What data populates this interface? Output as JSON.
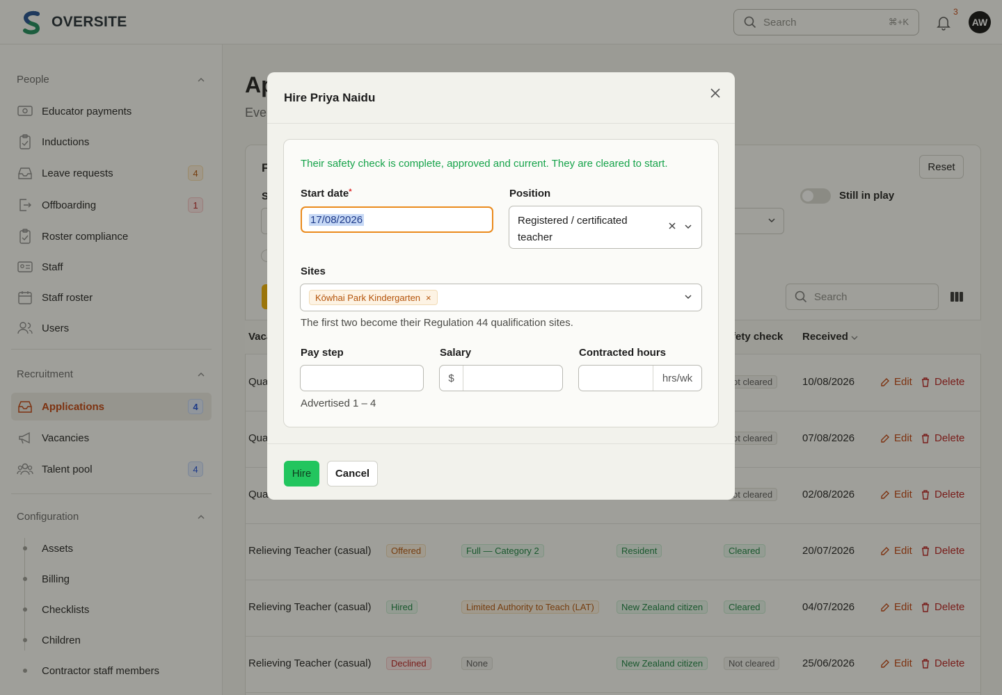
{
  "app": {
    "name": "OVERSITE",
    "accent": "#c2410c"
  },
  "topbar": {
    "search_placeholder": "Search",
    "search_shortcut": "⌘+K",
    "notification_count": "3",
    "avatar_initials": "AW"
  },
  "sidebar": {
    "people": {
      "title": "People",
      "items": [
        {
          "label": "Educator payments",
          "icon": "payment-icon"
        },
        {
          "label": "Inductions",
          "icon": "clipboard-check-icon"
        },
        {
          "label": "Leave requests",
          "icon": "inbox-icon",
          "badge": "4"
        },
        {
          "label": "Offboarding",
          "icon": "exit-icon",
          "badge": "1"
        },
        {
          "label": "Roster compliance",
          "icon": "clipboard-check-icon"
        },
        {
          "label": "Staff",
          "icon": "id-card-icon"
        },
        {
          "label": "Staff roster",
          "icon": "calendar-icon"
        },
        {
          "label": "Users",
          "icon": "users-icon"
        }
      ]
    },
    "recruitment": {
      "title": "Recruitment",
      "items": [
        {
          "label": "Applications",
          "icon": "inbox-stack-icon",
          "badge": "4",
          "active": true
        },
        {
          "label": "Vacancies",
          "icon": "megaphone-icon"
        },
        {
          "label": "Talent pool",
          "icon": "user-group-icon",
          "badge": "4"
        }
      ]
    },
    "configuration": {
      "title": "Configuration",
      "items": [
        "Assets",
        "Billing",
        "Checklists",
        "Children",
        "Contractor staff members"
      ]
    }
  },
  "background": {
    "title_partial": "Ap",
    "subtitle_partial": "Eve",
    "filter_partial": "F",
    "s_partial": "S",
    "reset": "Reset",
    "still_in_play": "Still in play",
    "search_placeholder": "Search",
    "headers": {
      "vacancy": "Vaca",
      "safety_check": "fety check",
      "received": "Received"
    },
    "rows": [
      {
        "vacancy": "Qua",
        "safety": "ot cleared",
        "received": "10/08/2026"
      },
      {
        "vacancy": "Qua",
        "safety": "ot cleared",
        "received": "07/08/2026"
      },
      {
        "vacancy": "Qua",
        "safety": "ot cleared",
        "received": "02/08/2026"
      },
      {
        "vacancy": "Relieving Teacher (casual)",
        "status": "Offered",
        "qualification": "Full — Category 2",
        "residency": "Resident",
        "safety": "Cleared",
        "received": "20/07/2026"
      },
      {
        "vacancy": "Relieving Teacher (casual)",
        "status": "Hired",
        "qualification": "Limited Authority to Teach (LAT)",
        "residency": "New Zealand citizen",
        "safety": "Cleared",
        "received": "04/07/2026"
      },
      {
        "vacancy": "Relieving Teacher (casual)",
        "status": "Declined",
        "qualification": "None",
        "residency": "New Zealand citizen",
        "safety": "Not cleared",
        "received": "25/06/2026"
      }
    ],
    "edit": "Edit",
    "delete": "Delete"
  },
  "modal": {
    "title": "Hire Priya Naidu",
    "success_message": "Their safety check is complete, approved and current. They are cleared to start.",
    "start_date": {
      "label": "Start date",
      "required_mark": "*",
      "value": "17/08/2026"
    },
    "position": {
      "label": "Position",
      "value": "Registered / certificated teacher"
    },
    "sites": {
      "label": "Sites",
      "tag": "Kōwhai Park Kindergarten",
      "tag_remove": "×",
      "hint": "The first two become their Regulation 44 qualification sites."
    },
    "pay_step": {
      "label": "Pay step",
      "value": ""
    },
    "salary": {
      "label": "Salary",
      "prefix": "$",
      "value": ""
    },
    "hours": {
      "label": "Contracted hours",
      "suffix": "hrs/wk",
      "value": ""
    },
    "advertised": "Advertised 1 – 4",
    "hire_button": "Hire",
    "cancel_button": "Cancel"
  }
}
